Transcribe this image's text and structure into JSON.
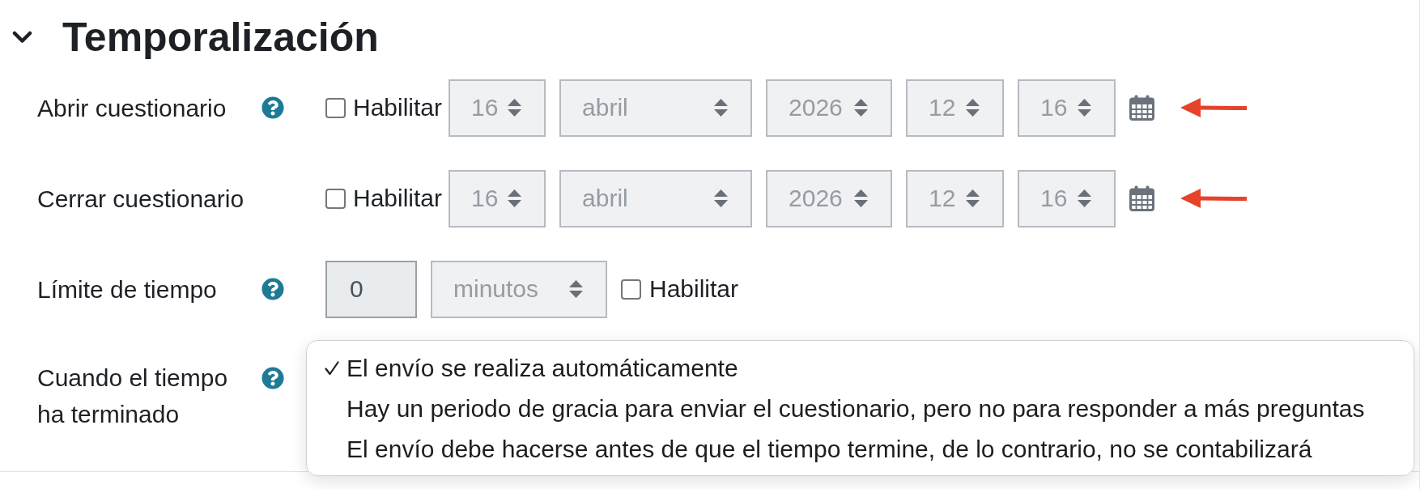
{
  "section": {
    "title": "Temporalización",
    "expanded": true
  },
  "rows": [
    {
      "kind": "datetime",
      "label": "Abrir cuestionario",
      "help": true,
      "annotated": true,
      "enable": {
        "label": "Habilitar",
        "checked": false
      },
      "fields": [
        "16",
        "abril",
        "2026",
        "12",
        "16"
      ]
    },
    {
      "kind": "datetime",
      "label": "Cerrar cuestionario",
      "help": false,
      "annotated": true,
      "enable": {
        "label": "Habilitar",
        "checked": false
      },
      "fields": [
        "16",
        "abril",
        "2026",
        "12",
        "16"
      ]
    },
    {
      "kind": "duration",
      "label": "Límite de tiempo",
      "help": true,
      "annotated": false,
      "value": "0",
      "unit": "minutos",
      "enable": {
        "label": "Habilitar",
        "checked": false
      }
    },
    {
      "kind": "select",
      "label": "Cuando el tiempo ha terminado",
      "help": true,
      "annotated": false,
      "options": [
        {
          "label": "El envío se realiza automáticamente",
          "selected": true
        },
        {
          "label": "Hay un periodo de gracia para enviar el cuestionario, pero no para responder a más preguntas",
          "selected": false
        },
        {
          "label": "El envío debe hacerse antes de que el tiempo termine, de lo contrario, no se contabilizará",
          "selected": false
        }
      ]
    }
  ]
}
